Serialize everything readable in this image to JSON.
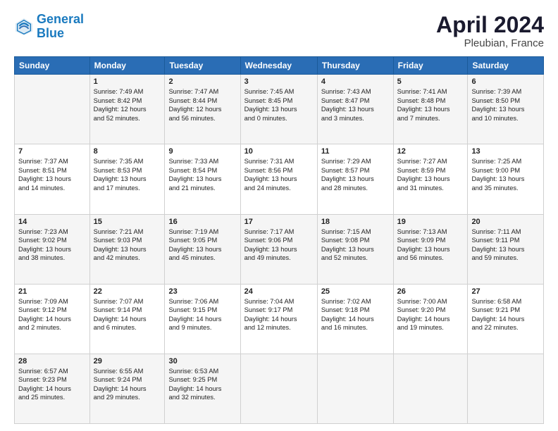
{
  "header": {
    "logo_line1": "General",
    "logo_line2": "Blue",
    "month": "April 2024",
    "location": "Pleubian, France"
  },
  "weekdays": [
    "Sunday",
    "Monday",
    "Tuesday",
    "Wednesday",
    "Thursday",
    "Friday",
    "Saturday"
  ],
  "weeks": [
    [
      {
        "day": "",
        "content": ""
      },
      {
        "day": "1",
        "content": "Sunrise: 7:49 AM\nSunset: 8:42 PM\nDaylight: 12 hours\nand 52 minutes."
      },
      {
        "day": "2",
        "content": "Sunrise: 7:47 AM\nSunset: 8:44 PM\nDaylight: 12 hours\nand 56 minutes."
      },
      {
        "day": "3",
        "content": "Sunrise: 7:45 AM\nSunset: 8:45 PM\nDaylight: 13 hours\nand 0 minutes."
      },
      {
        "day": "4",
        "content": "Sunrise: 7:43 AM\nSunset: 8:47 PM\nDaylight: 13 hours\nand 3 minutes."
      },
      {
        "day": "5",
        "content": "Sunrise: 7:41 AM\nSunset: 8:48 PM\nDaylight: 13 hours\nand 7 minutes."
      },
      {
        "day": "6",
        "content": "Sunrise: 7:39 AM\nSunset: 8:50 PM\nDaylight: 13 hours\nand 10 minutes."
      }
    ],
    [
      {
        "day": "7",
        "content": "Sunrise: 7:37 AM\nSunset: 8:51 PM\nDaylight: 13 hours\nand 14 minutes."
      },
      {
        "day": "8",
        "content": "Sunrise: 7:35 AM\nSunset: 8:53 PM\nDaylight: 13 hours\nand 17 minutes."
      },
      {
        "day": "9",
        "content": "Sunrise: 7:33 AM\nSunset: 8:54 PM\nDaylight: 13 hours\nand 21 minutes."
      },
      {
        "day": "10",
        "content": "Sunrise: 7:31 AM\nSunset: 8:56 PM\nDaylight: 13 hours\nand 24 minutes."
      },
      {
        "day": "11",
        "content": "Sunrise: 7:29 AM\nSunset: 8:57 PM\nDaylight: 13 hours\nand 28 minutes."
      },
      {
        "day": "12",
        "content": "Sunrise: 7:27 AM\nSunset: 8:59 PM\nDaylight: 13 hours\nand 31 minutes."
      },
      {
        "day": "13",
        "content": "Sunrise: 7:25 AM\nSunset: 9:00 PM\nDaylight: 13 hours\nand 35 minutes."
      }
    ],
    [
      {
        "day": "14",
        "content": "Sunrise: 7:23 AM\nSunset: 9:02 PM\nDaylight: 13 hours\nand 38 minutes."
      },
      {
        "day": "15",
        "content": "Sunrise: 7:21 AM\nSunset: 9:03 PM\nDaylight: 13 hours\nand 42 minutes."
      },
      {
        "day": "16",
        "content": "Sunrise: 7:19 AM\nSunset: 9:05 PM\nDaylight: 13 hours\nand 45 minutes."
      },
      {
        "day": "17",
        "content": "Sunrise: 7:17 AM\nSunset: 9:06 PM\nDaylight: 13 hours\nand 49 minutes."
      },
      {
        "day": "18",
        "content": "Sunrise: 7:15 AM\nSunset: 9:08 PM\nDaylight: 13 hours\nand 52 minutes."
      },
      {
        "day": "19",
        "content": "Sunrise: 7:13 AM\nSunset: 9:09 PM\nDaylight: 13 hours\nand 56 minutes."
      },
      {
        "day": "20",
        "content": "Sunrise: 7:11 AM\nSunset: 9:11 PM\nDaylight: 13 hours\nand 59 minutes."
      }
    ],
    [
      {
        "day": "21",
        "content": "Sunrise: 7:09 AM\nSunset: 9:12 PM\nDaylight: 14 hours\nand 2 minutes."
      },
      {
        "day": "22",
        "content": "Sunrise: 7:07 AM\nSunset: 9:14 PM\nDaylight: 14 hours\nand 6 minutes."
      },
      {
        "day": "23",
        "content": "Sunrise: 7:06 AM\nSunset: 9:15 PM\nDaylight: 14 hours\nand 9 minutes."
      },
      {
        "day": "24",
        "content": "Sunrise: 7:04 AM\nSunset: 9:17 PM\nDaylight: 14 hours\nand 12 minutes."
      },
      {
        "day": "25",
        "content": "Sunrise: 7:02 AM\nSunset: 9:18 PM\nDaylight: 14 hours\nand 16 minutes."
      },
      {
        "day": "26",
        "content": "Sunrise: 7:00 AM\nSunset: 9:20 PM\nDaylight: 14 hours\nand 19 minutes."
      },
      {
        "day": "27",
        "content": "Sunrise: 6:58 AM\nSunset: 9:21 PM\nDaylight: 14 hours\nand 22 minutes."
      }
    ],
    [
      {
        "day": "28",
        "content": "Sunrise: 6:57 AM\nSunset: 9:23 PM\nDaylight: 14 hours\nand 25 minutes."
      },
      {
        "day": "29",
        "content": "Sunrise: 6:55 AM\nSunset: 9:24 PM\nDaylight: 14 hours\nand 29 minutes."
      },
      {
        "day": "30",
        "content": "Sunrise: 6:53 AM\nSunset: 9:25 PM\nDaylight: 14 hours\nand 32 minutes."
      },
      {
        "day": "",
        "content": ""
      },
      {
        "day": "",
        "content": ""
      },
      {
        "day": "",
        "content": ""
      },
      {
        "day": "",
        "content": ""
      }
    ]
  ]
}
